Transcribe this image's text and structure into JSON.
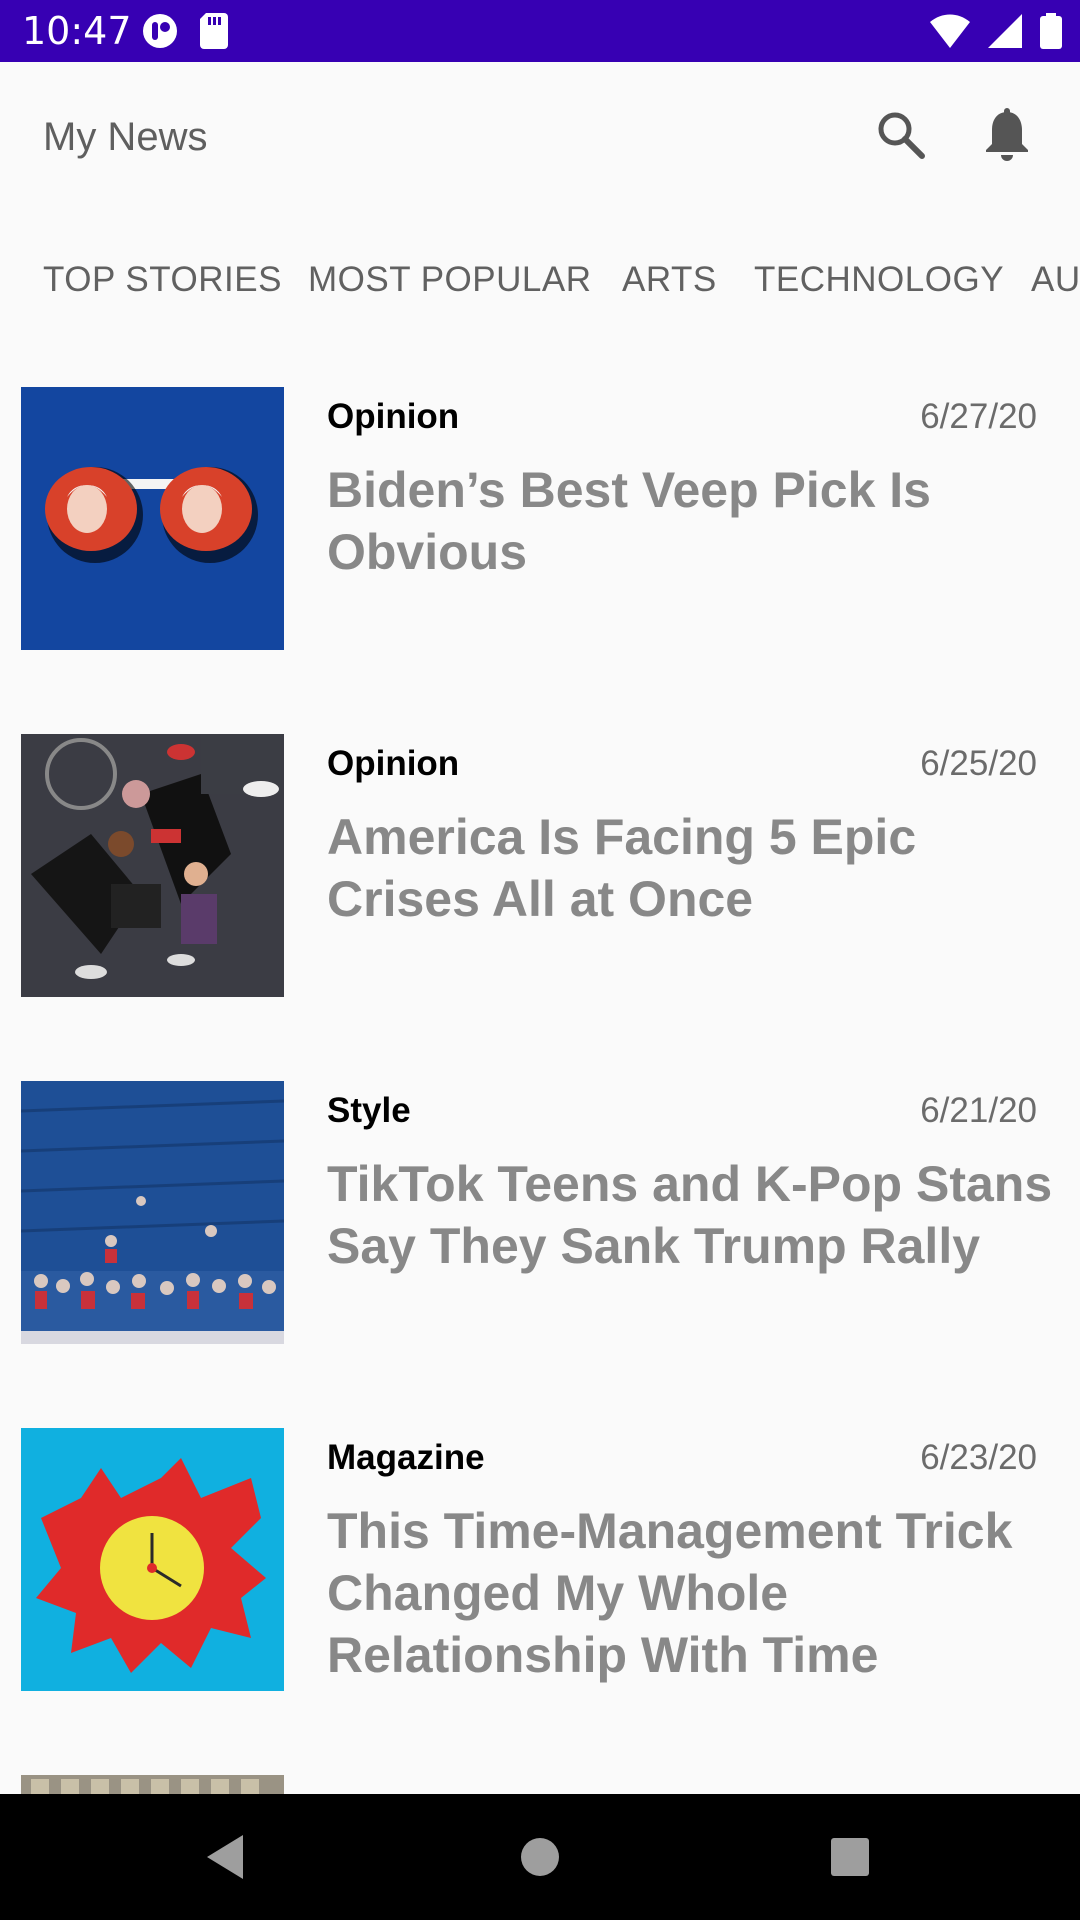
{
  "status_bar": {
    "time": "10:47",
    "icons": [
      "app-notification-icon",
      "sd-card-icon",
      "wifi-icon",
      "cell-signal-icon",
      "battery-icon"
    ],
    "background_color": "#3700b3"
  },
  "app_bar": {
    "title": "My News",
    "actions": [
      "search-icon",
      "notifications-icon"
    ]
  },
  "tabs": [
    {
      "label": "TOP STORIES"
    },
    {
      "label": "MOST POPULAR"
    },
    {
      "label": "ARTS"
    },
    {
      "label": "TECHNOLOGY"
    },
    {
      "label": "AU"
    }
  ],
  "articles": [
    {
      "section": "Opinion",
      "date": "6/27/20",
      "headline": "Biden’s Best Veep Pick Is Obvious"
    },
    {
      "section": "Opinion",
      "date": "6/25/20",
      "headline": "America Is Facing 5 Epic Crises All at Once"
    },
    {
      "section": "Style",
      "date": "6/21/20",
      "headline": "TikTok Teens and K-Pop Stans Say They Sank Trump Rally"
    },
    {
      "section": "Magazine",
      "date": "6/23/20",
      "headline": "This Time-Management Trick Changed My Whole Relationship With Time"
    }
  ],
  "nav_bar": {
    "buttons": [
      "back-icon",
      "home-icon",
      "recents-icon"
    ]
  },
  "colors": {
    "headline": "#888888",
    "section": "#000000",
    "tab_text": "#616161",
    "background": "#fafafa"
  }
}
